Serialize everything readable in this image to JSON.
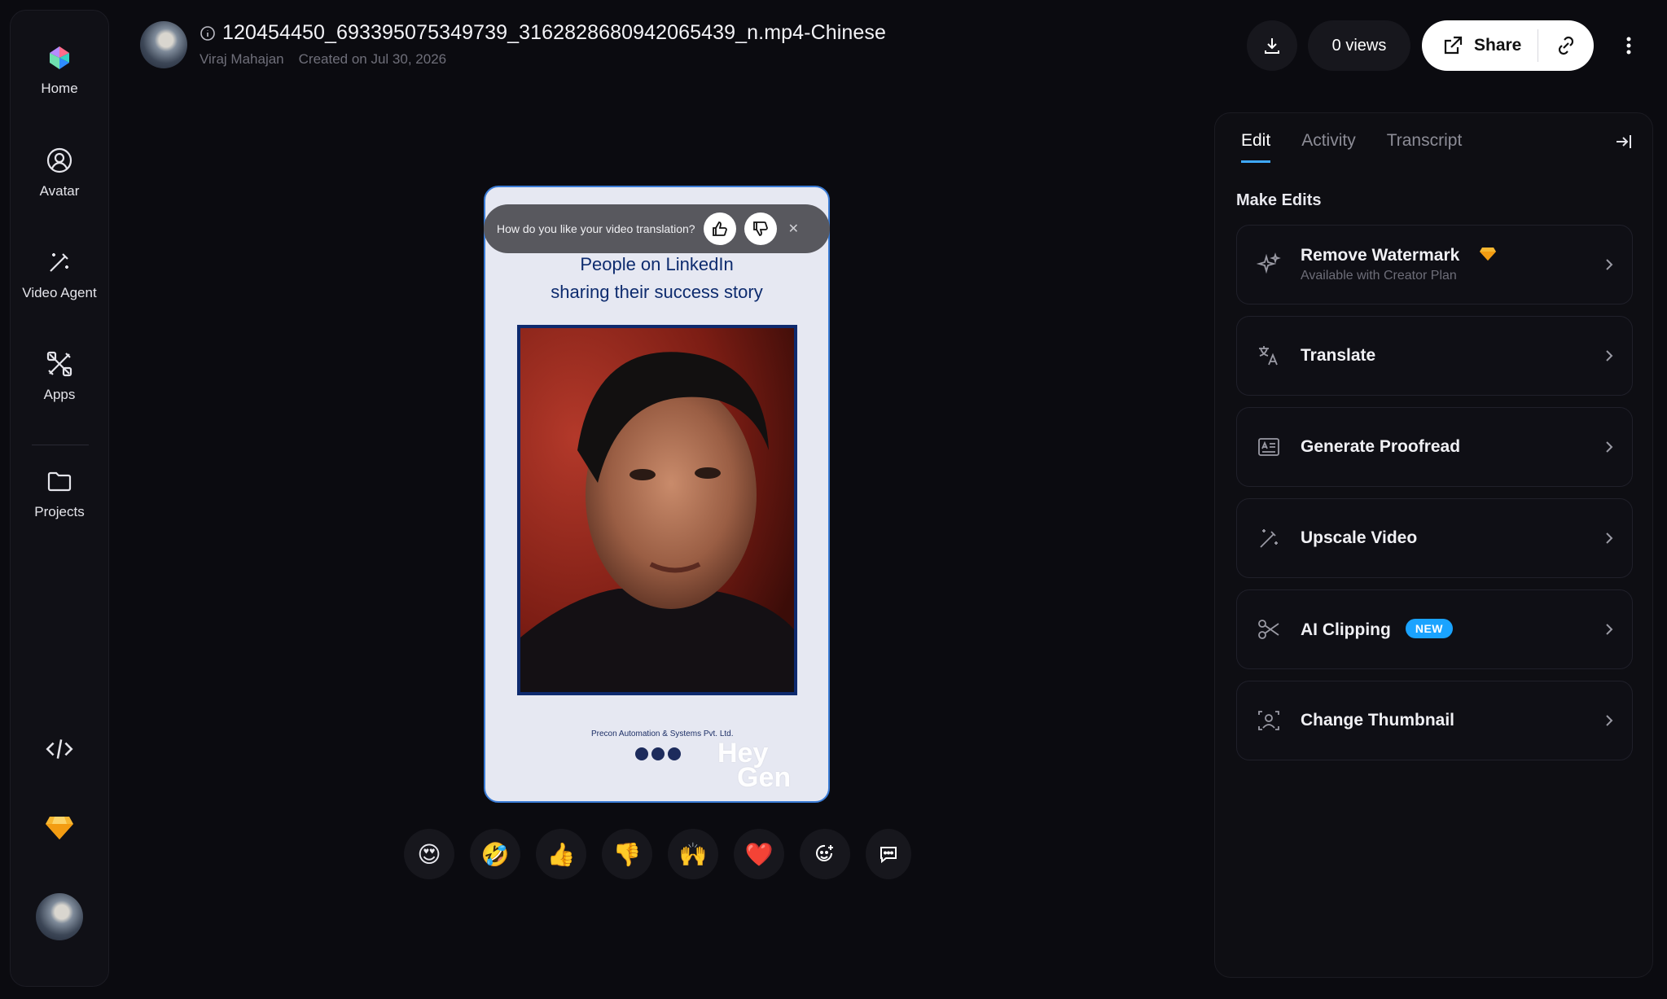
{
  "sidebar": {
    "items": [
      {
        "label": "Home"
      },
      {
        "label": "Avatar"
      },
      {
        "label": "Video Agent"
      },
      {
        "label": "Apps"
      },
      {
        "label": "Projects"
      }
    ]
  },
  "header": {
    "title": "120454450_693395075349739_3162828680942065439_n.mp4-Chinese",
    "author": "Viraj Mahajan",
    "created": "Created on Jul 30, 2026",
    "views_label": "0 views",
    "share_label": "Share"
  },
  "feedback": {
    "question": "How do you like your video translation?"
  },
  "video": {
    "headline_line1": "People on LinkedIn",
    "headline_line2": "sharing their success story",
    "company": "Precon Automation & Systems Pvt. Ltd.",
    "watermark_line1": "Hey",
    "watermark_line2": "Gen"
  },
  "reactions": [
    "😍",
    "🤣",
    "👍",
    "👎",
    "🙌",
    "❤️"
  ],
  "panel": {
    "tabs": [
      {
        "label": "Edit",
        "active": true
      },
      {
        "label": "Activity",
        "active": false
      },
      {
        "label": "Transcript",
        "active": false
      }
    ],
    "section_title": "Make Edits",
    "cards": [
      {
        "label": "Remove Watermark",
        "sub": "Available with Creator Plan",
        "icon": "sparkle-icon"
      },
      {
        "label": "Translate",
        "icon": "translate-icon"
      },
      {
        "label": "Generate Proofread",
        "icon": "proofread-icon"
      },
      {
        "label": "Upscale Video",
        "icon": "magic-wand-icon"
      },
      {
        "label": "AI Clipping",
        "badge": "NEW",
        "icon": "scissors-icon"
      },
      {
        "label": "Change Thumbnail",
        "icon": "thumbnail-icon"
      }
    ]
  },
  "colors": {
    "accent": "#1aa3ff",
    "background": "#0b0b10",
    "premium": "#f7b731"
  }
}
